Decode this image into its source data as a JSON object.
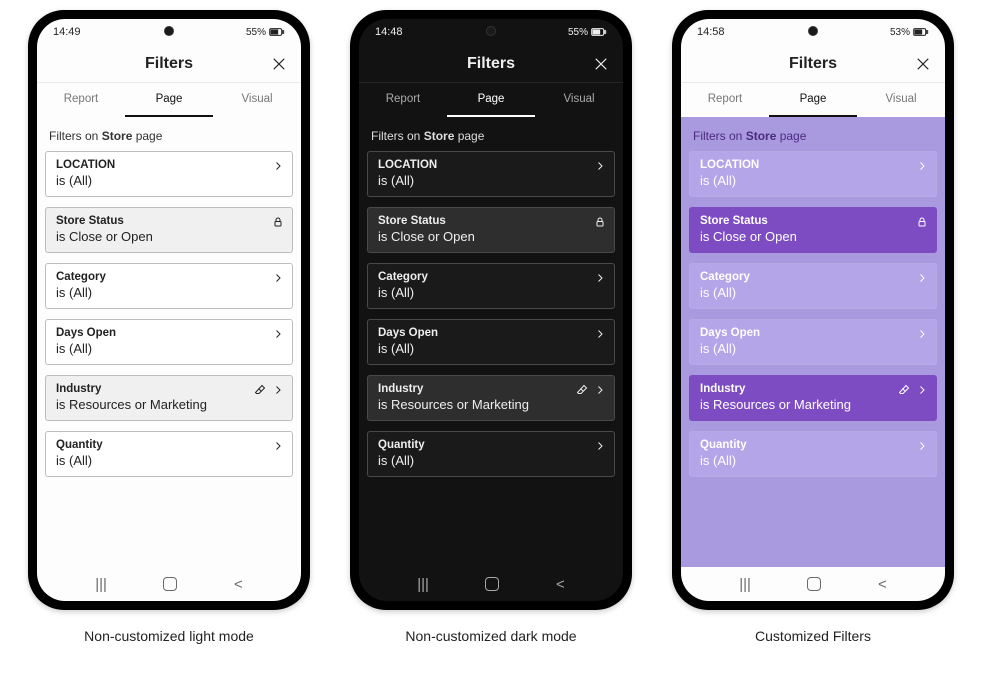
{
  "phones": [
    {
      "theme": "light",
      "caption": "Non-customized light mode",
      "status": {
        "time": "14:49",
        "battery": "55%"
      },
      "header": {
        "title": "Filters"
      },
      "tabs": {
        "items": [
          "Report",
          "Page",
          "Visual"
        ],
        "activeIndex": 1
      },
      "sectionLabel": {
        "prefix": "Filters on ",
        "bold": "Store",
        "suffix": " page"
      },
      "filters": [
        {
          "name": "LOCATION",
          "value": "is (All)",
          "chevron": true,
          "locked": false,
          "pinned": false
        },
        {
          "name": "Store Status",
          "value": "is Close or Open",
          "chevron": false,
          "locked": true,
          "pinned": false
        },
        {
          "name": "Category",
          "value": "is (All)",
          "chevron": true,
          "locked": false,
          "pinned": false
        },
        {
          "name": "Days Open",
          "value": "is (All)",
          "chevron": true,
          "locked": false,
          "pinned": false
        },
        {
          "name": "Industry",
          "value": "is Resources or Marketing",
          "chevron": true,
          "locked": false,
          "pinned": true
        },
        {
          "name": "Quantity",
          "value": "is (All)",
          "chevron": true,
          "locked": false,
          "pinned": false
        }
      ]
    },
    {
      "theme": "dark",
      "caption": "Non-customized dark mode",
      "status": {
        "time": "14:48",
        "battery": "55%"
      },
      "header": {
        "title": "Filters"
      },
      "tabs": {
        "items": [
          "Report",
          "Page",
          "Visual"
        ],
        "activeIndex": 1
      },
      "sectionLabel": {
        "prefix": "Filters on ",
        "bold": "Store",
        "suffix": " page"
      },
      "filters": [
        {
          "name": "LOCATION",
          "value": "is (All)",
          "chevron": true,
          "locked": false,
          "pinned": false
        },
        {
          "name": "Store Status",
          "value": "is Close or Open",
          "chevron": false,
          "locked": true,
          "pinned": false
        },
        {
          "name": "Category",
          "value": "is (All)",
          "chevron": true,
          "locked": false,
          "pinned": false
        },
        {
          "name": "Days Open",
          "value": "is (All)",
          "chevron": true,
          "locked": false,
          "pinned": false
        },
        {
          "name": "Industry",
          "value": "is Resources or Marketing",
          "chevron": true,
          "locked": false,
          "pinned": true
        },
        {
          "name": "Quantity",
          "value": "is (All)",
          "chevron": true,
          "locked": false,
          "pinned": false
        }
      ]
    },
    {
      "theme": "custom",
      "caption": "Customized Filters",
      "status": {
        "time": "14:58",
        "battery": "53%"
      },
      "header": {
        "title": "Filters"
      },
      "tabs": {
        "items": [
          "Report",
          "Page",
          "Visual"
        ],
        "activeIndex": 1
      },
      "sectionLabel": {
        "prefix": "Filters on ",
        "bold": "Store",
        "suffix": " page"
      },
      "filters": [
        {
          "name": "LOCATION",
          "value": "is (All)",
          "chevron": true,
          "locked": false,
          "pinned": false
        },
        {
          "name": "Store Status",
          "value": "is Close or Open",
          "chevron": false,
          "locked": true,
          "pinned": false
        },
        {
          "name": "Category",
          "value": "is (All)",
          "chevron": true,
          "locked": false,
          "pinned": false
        },
        {
          "name": "Days Open",
          "value": "is (All)",
          "chevron": true,
          "locked": false,
          "pinned": false
        },
        {
          "name": "Industry",
          "value": "is Resources or Marketing",
          "chevron": true,
          "locked": false,
          "pinned": true
        },
        {
          "name": "Quantity",
          "value": "is (All)",
          "chevron": true,
          "locked": false,
          "pinned": false
        }
      ]
    }
  ]
}
